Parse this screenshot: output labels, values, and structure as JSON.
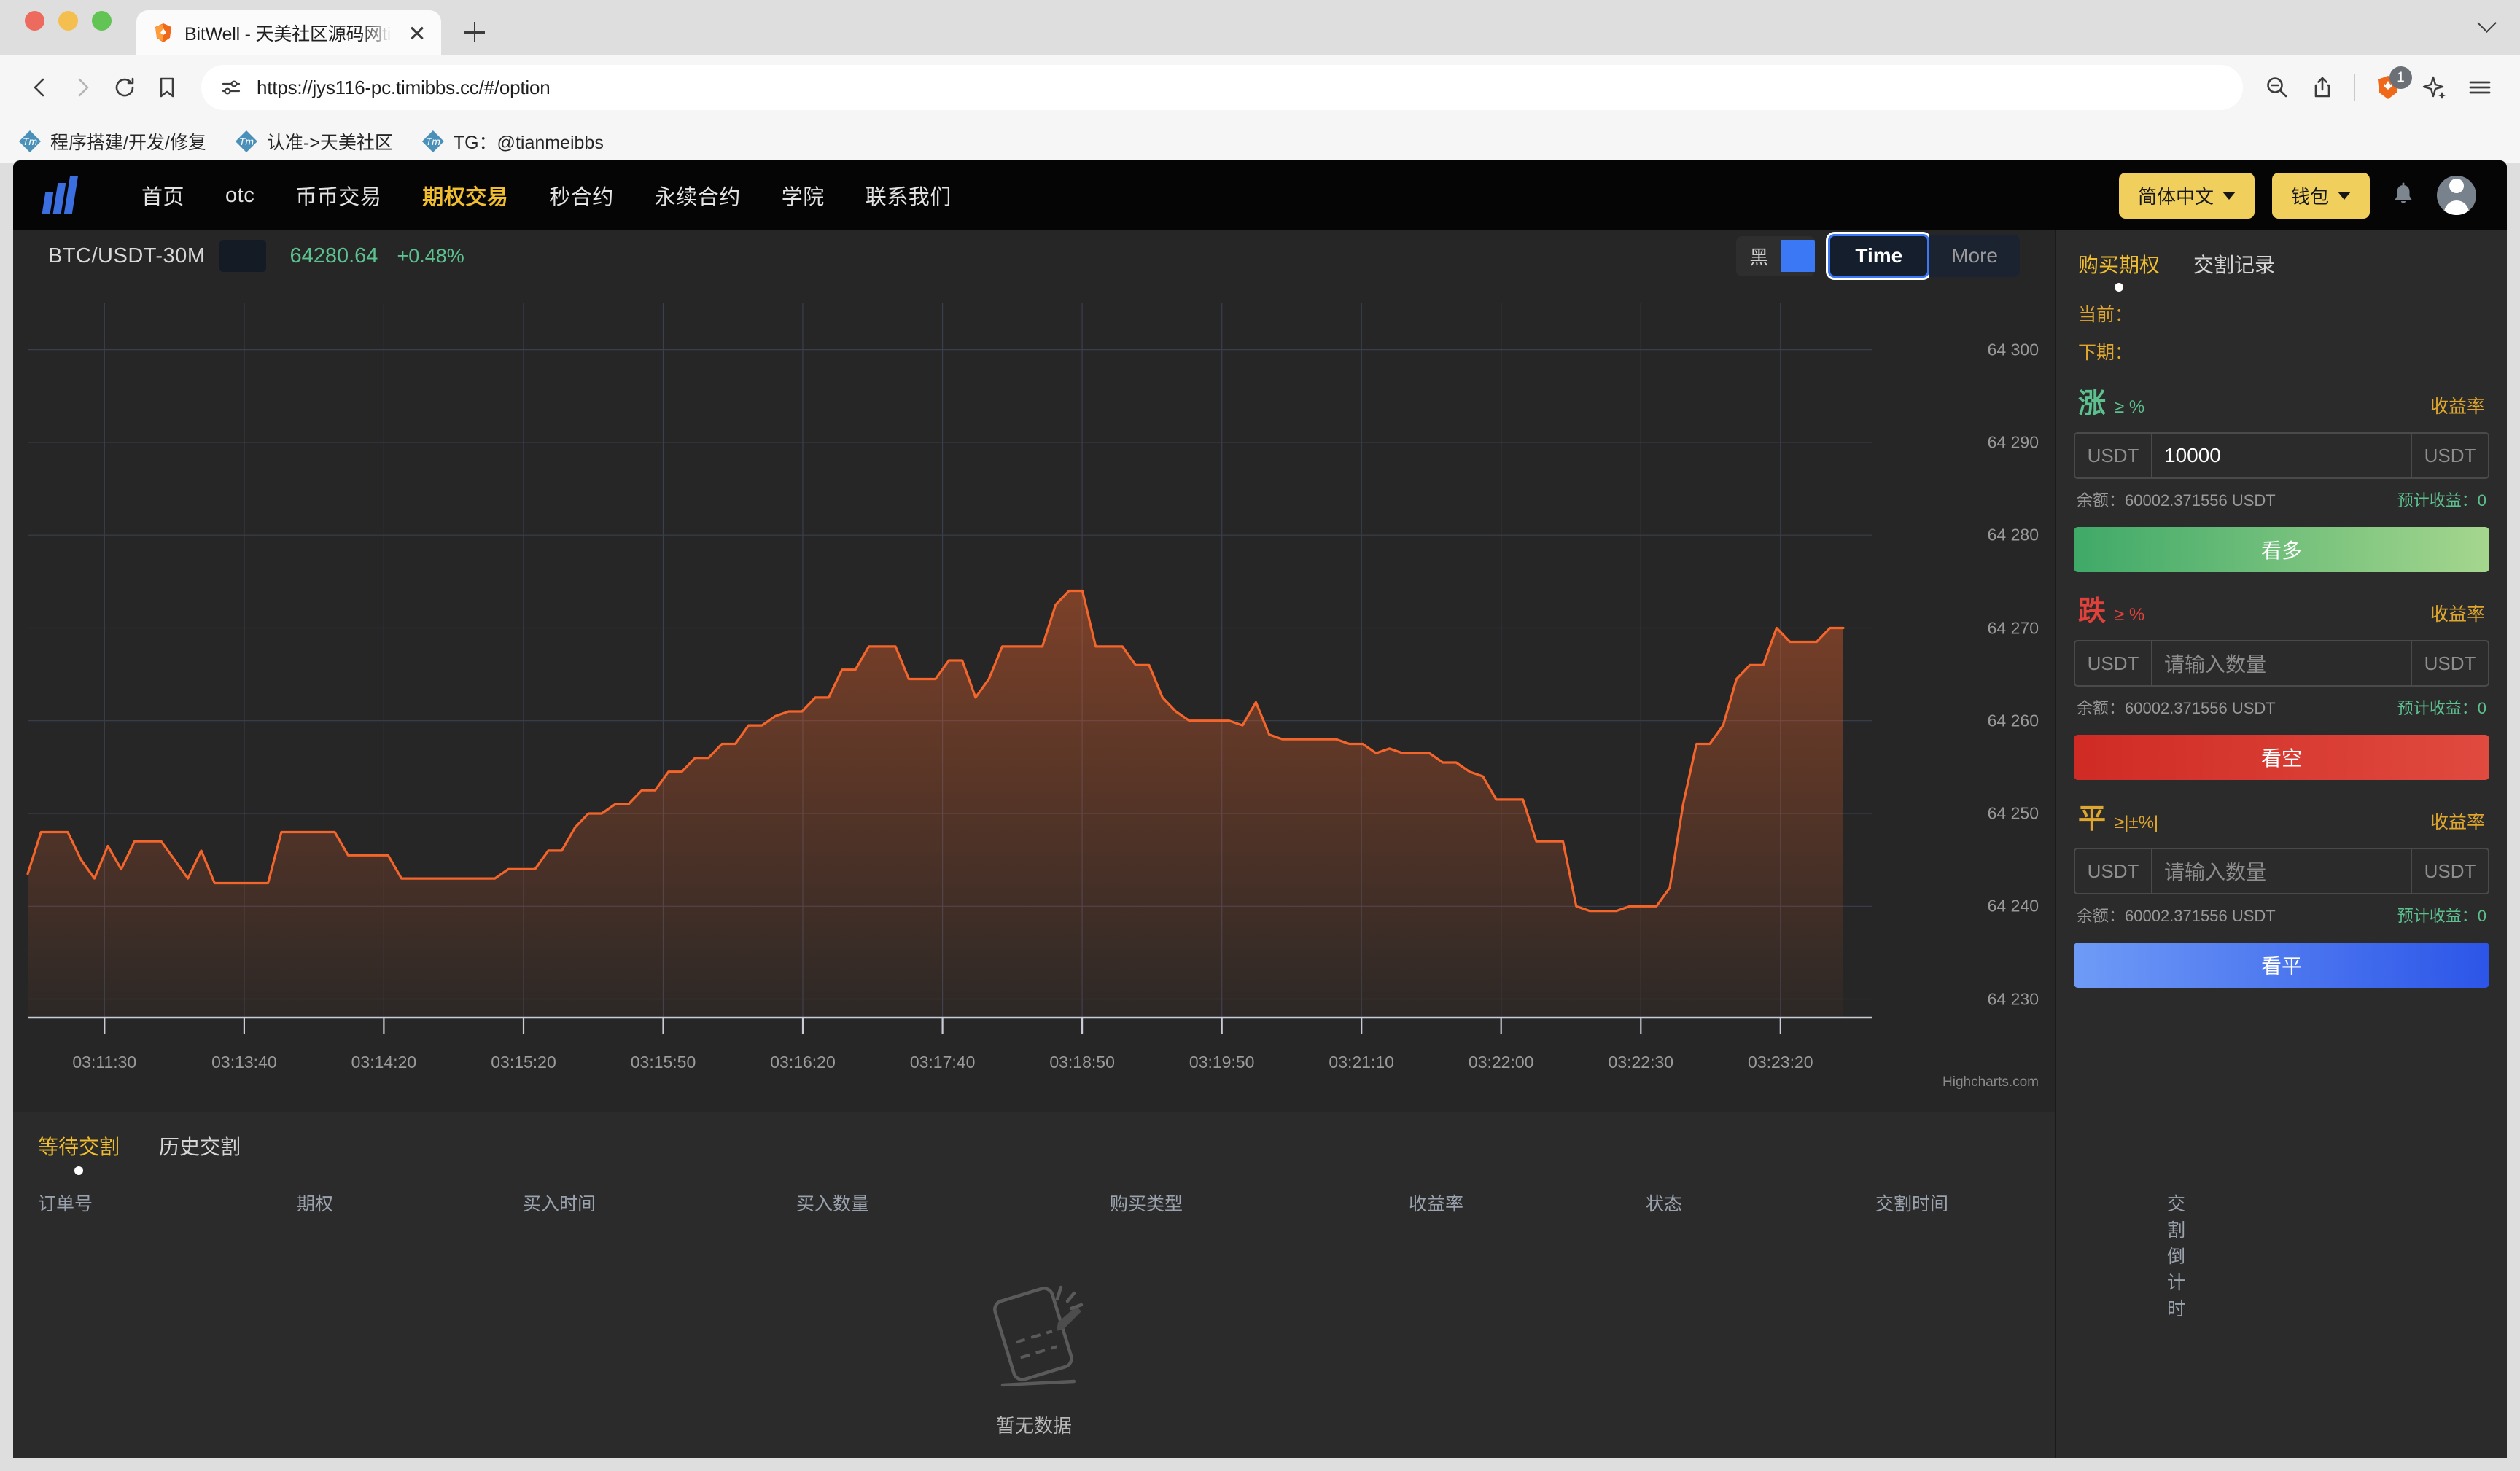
{
  "browser": {
    "tab": {
      "title": "BitWell - 天美社区源码网timib",
      "favicon": "brave-lion-icon"
    },
    "url": "https://jys116-pc.timibbs.cc/#/option",
    "shield_count": "1",
    "bookmarks": [
      {
        "label": "程序搭建/开发/修复",
        "icon": "tm-icon"
      },
      {
        "label": "认准->天美社区",
        "icon": "tm-icon"
      },
      {
        "label": "TG：@tianmeibbs",
        "icon": "tm-icon"
      }
    ]
  },
  "site": {
    "nav_links": [
      {
        "label": "首页",
        "active": false
      },
      {
        "label": "otc",
        "active": false
      },
      {
        "label": "币币交易",
        "active": false
      },
      {
        "label": "期权交易",
        "active": true
      },
      {
        "label": "秒合约",
        "active": false
      },
      {
        "label": "永续合约",
        "active": false
      },
      {
        "label": "学院",
        "active": false
      },
      {
        "label": "联系我们",
        "active": false
      }
    ],
    "language_label": "简体中文",
    "wallet_label": "钱包",
    "accent_yellow": "#f0cf5d"
  },
  "chart_header": {
    "symbol": "BTC/USDT-30M",
    "price": "64280.64",
    "change": "+0.48%",
    "theme_label": "黑",
    "theme_swatch": "#3b78f5",
    "time_button": "Time",
    "more_button": "More"
  },
  "chart_data": {
    "type": "line",
    "title": "BTC/USDT-30M",
    "xlabel": "",
    "ylabel": "",
    "grid": true,
    "legend": false,
    "line_color": "#f4652b",
    "ylim": [
      64228,
      64305
    ],
    "yticks": [
      "64 230",
      "64 240",
      "64 250",
      "64 260",
      "64 270",
      "64 280",
      "64 290",
      "64 300"
    ],
    "ytick_values": [
      64230,
      64240,
      64250,
      64260,
      64270,
      64280,
      64290,
      64300
    ],
    "xticks": [
      "03:11:30",
      "03:13:40",
      "03:14:20",
      "03:15:20",
      "03:15:50",
      "03:16:20",
      "03:17:40",
      "03:18:50",
      "03:19:50",
      "03:21:10",
      "03:22:00",
      "03:22:30",
      "03:23:20"
    ],
    "credit": "Highcharts.com",
    "series": [
      {
        "name": "BTC/USDT",
        "values": [
          64243.5,
          64248.0,
          64248.0,
          64248.0,
          64245.0,
          64243.0,
          64246.5,
          64244.0,
          64247.0,
          64247.0,
          64247.0,
          64245.0,
          64243.0,
          64246.0,
          64242.5,
          64242.5,
          64242.5,
          64242.5,
          64242.5,
          64248.0,
          64248.0,
          64248.0,
          64248.0,
          64248.0,
          64245.5,
          64245.5,
          64245.5,
          64245.5,
          64243.0,
          64243.0,
          64243.0,
          64243.0,
          64243.0,
          64243.0,
          64243.0,
          64243.0,
          64244.0,
          64244.0,
          64244.0,
          64246.0,
          64246.0,
          64248.5,
          64250.0,
          64250.0,
          64251.0,
          64251.0,
          64252.5,
          64252.5,
          64254.5,
          64254.5,
          64256.0,
          64256.0,
          64257.5,
          64257.5,
          64259.5,
          64259.5,
          64260.5,
          64261.0,
          64261.0,
          64262.5,
          64262.5,
          64265.5,
          64265.5,
          64268.0,
          64268.0,
          64268.0,
          64264.5,
          64264.5,
          64264.5,
          64266.5,
          64266.5,
          64262.5,
          64264.5,
          64268.0,
          64268.0,
          64268.0,
          64268.0,
          64272.5,
          64274.0,
          64274.0,
          64268.0,
          64268.0,
          64268.0,
          64266.0,
          64266.0,
          64262.5,
          64261.0,
          64260.0,
          64260.0,
          64260.0,
          64260.0,
          64259.5,
          64262.0,
          64258.5,
          64258.0,
          64258.0,
          64258.0,
          64258.0,
          64258.0,
          64257.5,
          64257.5,
          64256.5,
          64257.0,
          64256.5,
          64256.5,
          64256.5,
          64255.5,
          64255.5,
          64254.5,
          64254.0,
          64251.5,
          64251.5,
          64251.5,
          64247.0,
          64247.0,
          64247.0,
          64240.0,
          64239.5,
          64239.5,
          64239.5,
          64240.0,
          64240.0,
          64240.0,
          64242.0,
          64251.0,
          64257.5,
          64257.5,
          64259.5,
          64264.5,
          64266.0,
          64266.0,
          64270.0,
          64268.5,
          64268.5,
          64268.5,
          64270.0,
          64270.0
        ]
      }
    ]
  },
  "trade": {
    "tabs": [
      {
        "label": "购买期权",
        "active": true
      },
      {
        "label": "交割记录",
        "active": false
      }
    ],
    "current_label": "当前：",
    "next_label": "下期：",
    "sections": [
      {
        "dir": "涨",
        "dir_kind": "up",
        "condition": "≥ %",
        "rate_label": "收益率",
        "prefix": "USDT",
        "value": "10000",
        "placeholder": "",
        "suffix": "USDT",
        "balance": "余额：60002.371556 USDT",
        "estimate": "预计收益：0",
        "action": "看多"
      },
      {
        "dir": "跌",
        "dir_kind": "down",
        "condition": "≥ %",
        "rate_label": "收益率",
        "prefix": "USDT",
        "value": "",
        "placeholder": "请输入数量",
        "suffix": "USDT",
        "balance": "余额：60002.371556 USDT",
        "estimate": "预计收益：0",
        "action": "看空"
      },
      {
        "dir": "平",
        "dir_kind": "flat",
        "condition": "≥|±%|",
        "rate_label": "收益率",
        "prefix": "USDT",
        "value": "",
        "placeholder": "请输入数量",
        "suffix": "USDT",
        "balance": "余额：60002.371556 USDT",
        "estimate": "预计收益：0",
        "action": "看平"
      }
    ]
  },
  "orders": {
    "tabs": [
      {
        "label": "等待交割",
        "active": true
      },
      {
        "label": "历史交割",
        "active": false
      }
    ],
    "columns": [
      "订单号",
      "期权",
      "买入时间",
      "买入数量",
      "购买类型",
      "收益率",
      "状态",
      "交割时间",
      "交割倒计时"
    ],
    "empty_text": "暂无数据",
    "rows": []
  }
}
